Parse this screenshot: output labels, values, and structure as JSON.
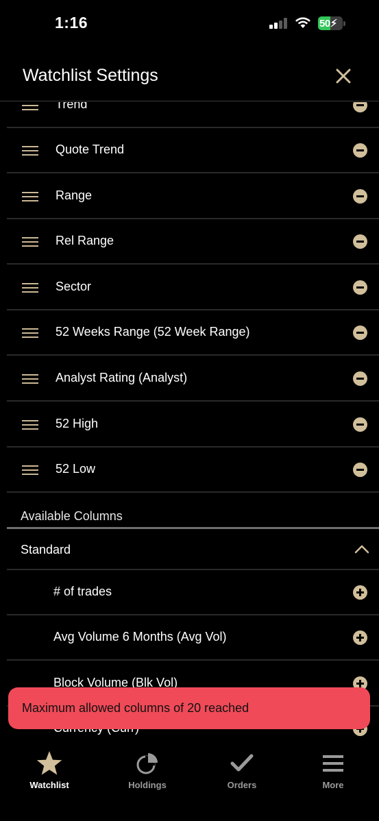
{
  "status_bar": {
    "time": "1:16",
    "battery_level": "50",
    "battery_fraction": 0.5,
    "battery_color": "#33c759"
  },
  "header": {
    "title": "Watchlist Settings",
    "close_icon": "close-icon"
  },
  "selected_columns": [
    {
      "label": "Trend",
      "action": "remove"
    },
    {
      "label": "Quote Trend",
      "action": "remove"
    },
    {
      "label": "Range",
      "action": "remove"
    },
    {
      "label": "Rel Range",
      "action": "remove"
    },
    {
      "label": "Sector",
      "action": "remove"
    },
    {
      "label": "52 Weeks Range  (52 Week Range)",
      "action": "remove"
    },
    {
      "label": "Analyst Rating  (Analyst)",
      "action": "remove"
    },
    {
      "label": "52 High",
      "action": "remove"
    },
    {
      "label": "52 Low",
      "action": "remove"
    }
  ],
  "available": {
    "section_label": "Available Columns",
    "category": "Standard",
    "category_expanded": true,
    "items": [
      {
        "label": "# of trades",
        "action": "add"
      },
      {
        "label": "Avg Volume 6 Months  (Avg Vol)",
        "action": "add"
      },
      {
        "label": "Block Volume  (Blk Vol)",
        "action": "add"
      },
      {
        "label": "Currency  (Curr)",
        "action": "add"
      }
    ]
  },
  "toast": {
    "message": "Maximum allowed columns of 20 reached",
    "color": "#f04a58"
  },
  "tabbar": {
    "tabs": [
      {
        "label": "Watchlist",
        "icon": "star-icon",
        "active": true
      },
      {
        "label": "Holdings",
        "icon": "pie-chart-icon",
        "active": false
      },
      {
        "label": "Orders",
        "icon": "checkmark-icon",
        "active": false
      },
      {
        "label": "More",
        "icon": "menu-icon",
        "active": false
      }
    ]
  },
  "colors": {
    "accent": "#d1bf9b",
    "background": "#000000"
  }
}
